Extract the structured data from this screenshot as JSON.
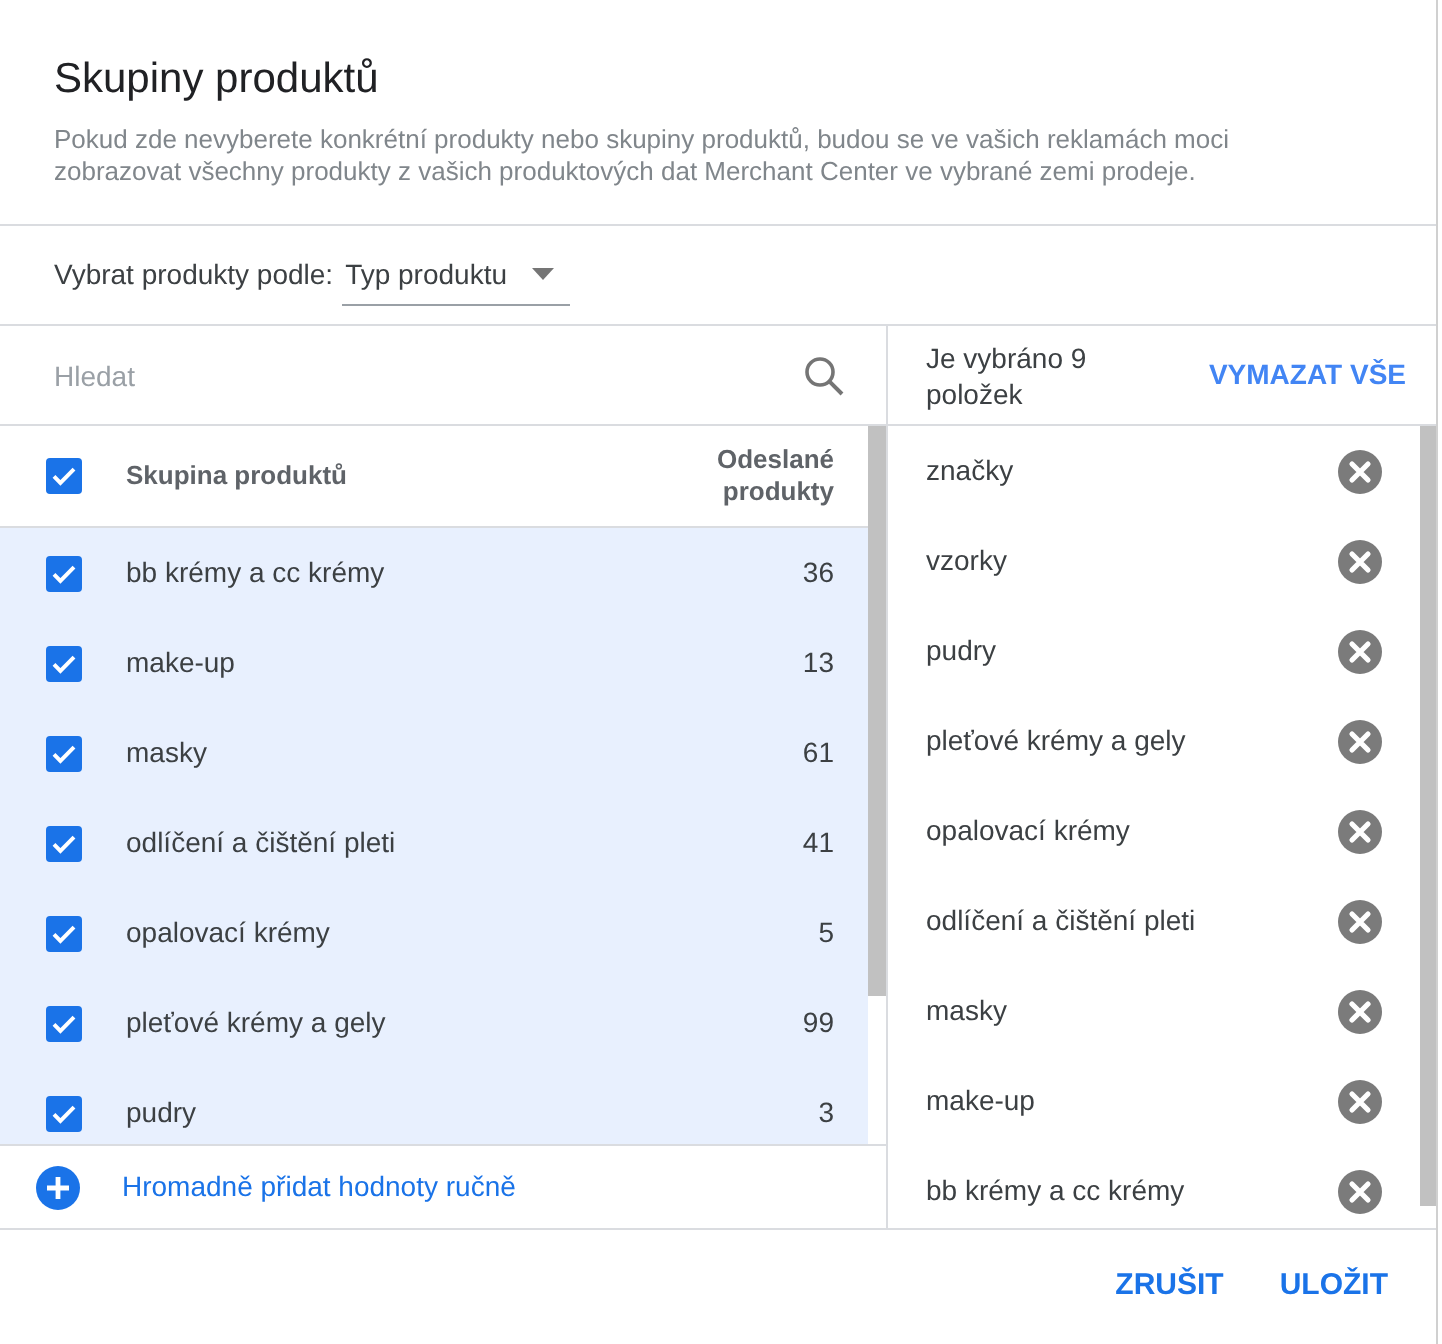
{
  "dialog": {
    "title": "Skupiny produktů",
    "description": "Pokud zde nevyberete konkrétní produkty nebo skupiny produktů, budou se ve vašich reklamách moci zobrazovat všechny produkty z vašich produktových dat Merchant Center ve vybrané zemi prodeje."
  },
  "filter": {
    "label": "Vybrat produkty podle:",
    "value": "Typ produktu"
  },
  "search": {
    "placeholder": "Hledat"
  },
  "table": {
    "select_all_checked": true,
    "columns": [
      "Skupina produktů",
      "Odeslané produkty"
    ],
    "rows": [
      {
        "name": "bb krémy a cc krémy",
        "count": "36",
        "checked": true
      },
      {
        "name": "make-up",
        "count": "13",
        "checked": true
      },
      {
        "name": "masky",
        "count": "61",
        "checked": true
      },
      {
        "name": "odlíčení a čištění pleti",
        "count": "41",
        "checked": true
      },
      {
        "name": "opalovací krémy",
        "count": "5",
        "checked": true
      },
      {
        "name": "pleťové krémy a gely",
        "count": "99",
        "checked": true
      },
      {
        "name": "pudry",
        "count": "3",
        "checked": true
      }
    ]
  },
  "bulk_add": {
    "label": "Hromadně přidat hodnoty ručně"
  },
  "selected_panel": {
    "summary": "Je vybráno 9 položek",
    "clear_all": "VYMAZAT VŠE",
    "items": [
      "značky",
      "vzorky",
      "pudry",
      "pleťové krémy a gely",
      "opalovací krémy",
      "odlíčení a čištění pleti",
      "masky",
      "make-up",
      "bb krémy a cc krémy"
    ]
  },
  "buttons": [
    "ZRUŠIT",
    "ULOŽIT"
  ]
}
